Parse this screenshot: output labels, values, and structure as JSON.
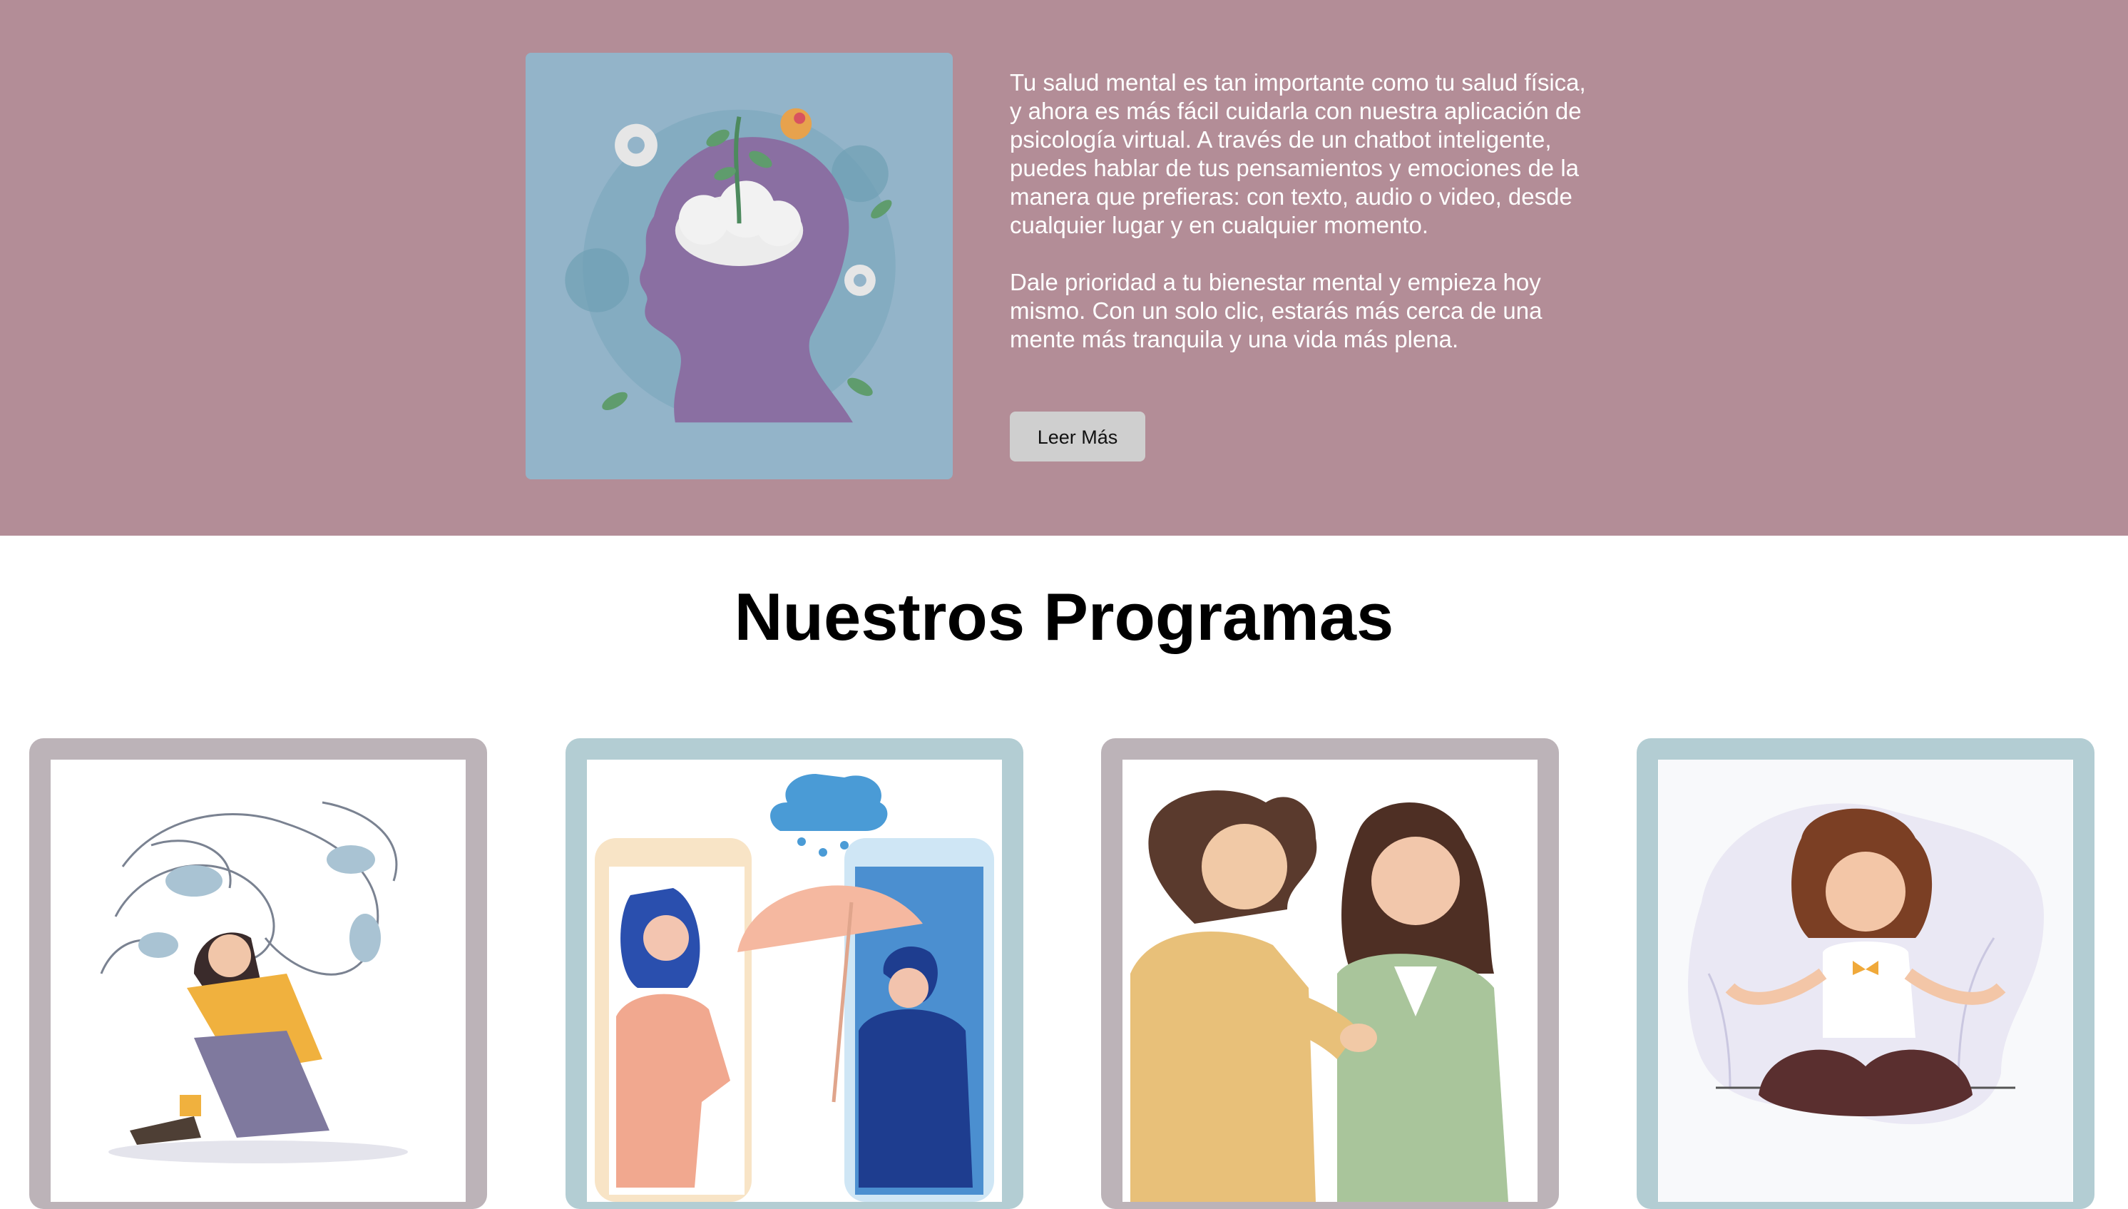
{
  "hero": {
    "paragraph_1": "Tu salud mental es tan importante como tu salud física, y ahora es más fácil cuidarla con nuestra aplicación de psicología virtual. A través de un chatbot inteligente, puedes hablar de tus pensamientos y emociones de la manera que prefieras: con texto, audio o video, desde cualquier lugar y en cualquier momento.",
    "paragraph_2": "Dale prioridad a tu bienestar mental y empieza hoy mismo. Con un solo clic, estarás más cerca de una mente más tranquila y una vida más plena.",
    "button_label": "Leer Más",
    "image_icon": "mind-head-illustration"
  },
  "programs": {
    "title": "Nuestros Programas",
    "cards": [
      {
        "icon": "anxious-woman-illustration"
      },
      {
        "icon": "video-call-support-illustration"
      },
      {
        "icon": "friend-comfort-illustration"
      },
      {
        "icon": "meditation-illustration"
      }
    ]
  },
  "colors": {
    "hero_bg": "#b38d97",
    "card_mauve": "#bcb3b8",
    "card_blue": "#b3cdd3",
    "button_bg": "#cfcfcf"
  }
}
